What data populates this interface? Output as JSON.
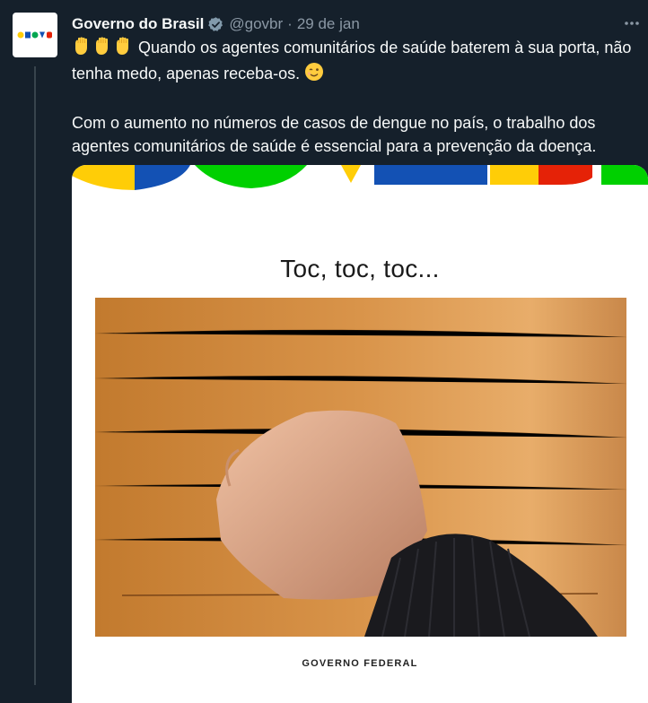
{
  "tweet": {
    "author_name": "Governo do Brasil",
    "handle": "@govbr",
    "separator": "·",
    "date": "29 de jan",
    "emojis": [
      "raised-fist-icon",
      "raised-fist-icon",
      "raised-fist-icon"
    ],
    "paragraph1": "Quando os agentes comunitários de saúde baterem à sua porta, não tenha medo, apenas receba-os.",
    "wink_emoji": "winking-face-icon",
    "paragraph2": "Com o aumento no números de casos de dengue no país, o trabalho dos agentes comunitários de saúde é essencial para a prevenção da doença."
  },
  "media": {
    "title": "Toc, toc, toc...",
    "footer": "GOVERNO FEDERAL"
  },
  "colors": {
    "background": "#15202b",
    "text": "#f7f9f9",
    "secondary_text": "#8b98a5",
    "verified_badge": "#829aab",
    "brand_yellow": "#ffcd07",
    "brand_blue": "#1351b4",
    "brand_green": "#00d000",
    "brand_red": "#e52207"
  }
}
